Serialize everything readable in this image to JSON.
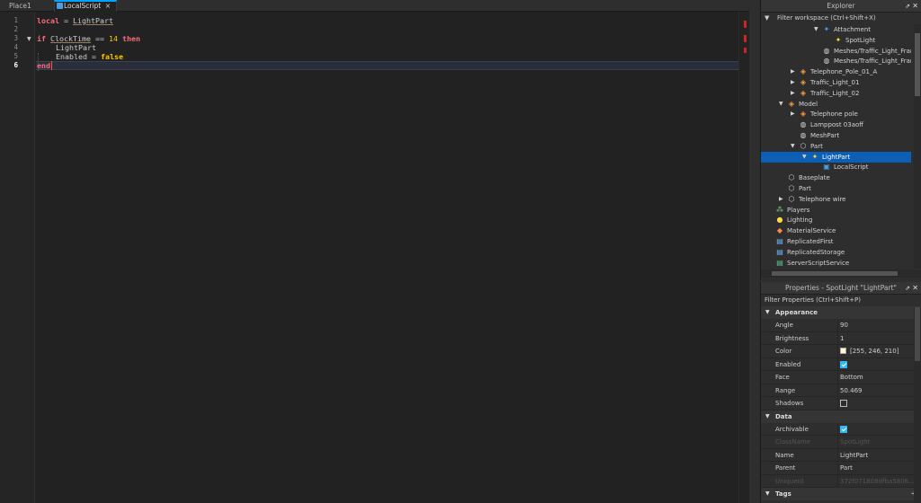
{
  "tabs": [
    {
      "label": "Place1",
      "active": false
    },
    {
      "label": "LocalScript",
      "active": true,
      "close": "×"
    }
  ],
  "editor": {
    "line_numbers": [
      "1",
      "2",
      "3",
      "4",
      "5",
      "6"
    ],
    "current_line": "6",
    "lines": {
      "l1": {
        "kw": "local",
        "op": "=",
        "ident": "LightPart"
      },
      "l3": {
        "kw_if": "if",
        "ident": "ClockTime",
        "op": "==",
        "num": "14",
        "kw_then": "then"
      },
      "l4": {
        "ident": "LightPart"
      },
      "l5": {
        "ident": "Enabled",
        "op": "=",
        "bool": "false"
      },
      "l6": {
        "kw": "end"
      }
    }
  },
  "explorer": {
    "title": "Explorer",
    "filter_placeholder": "Filter workspace (Ctrl+Shift+X)",
    "items": [
      {
        "label": "Attachment",
        "icon": "attachment-icon",
        "indent": 4,
        "arrow": "down"
      },
      {
        "label": "SpotLight",
        "icon": "spotlight-icon",
        "indent": 5,
        "arrow": ""
      },
      {
        "label": "Meshes/Traffic_Light_Frame_S",
        "icon": "mesh-icon",
        "indent": 4,
        "arrow": ""
      },
      {
        "label": "Meshes/Traffic_Light_Frame_S",
        "icon": "mesh-icon",
        "indent": 4,
        "arrow": ""
      },
      {
        "label": "Telephone_Pole_01_A",
        "icon": "model-icon",
        "indent": 2,
        "arrow": "right"
      },
      {
        "label": "Traffic_Light_01",
        "icon": "model-icon",
        "indent": 2,
        "arrow": "right"
      },
      {
        "label": "Traffic_Light_02",
        "icon": "model-icon",
        "indent": 2,
        "arrow": "right"
      },
      {
        "label": "Model",
        "icon": "model-icon",
        "indent": 1,
        "arrow": "down"
      },
      {
        "label": "Telephone pole",
        "icon": "model-icon",
        "indent": 2,
        "arrow": "right"
      },
      {
        "label": "Lamppost 03aoff",
        "icon": "mesh-icon",
        "indent": 2,
        "arrow": ""
      },
      {
        "label": "MeshPart",
        "icon": "mesh-icon",
        "indent": 2,
        "arrow": ""
      },
      {
        "label": "Part",
        "icon": "part-icon",
        "indent": 2,
        "arrow": "down"
      },
      {
        "label": "LightPart",
        "icon": "spotlight-icon",
        "indent": 3,
        "arrow": "down",
        "selected": true
      },
      {
        "label": "LocalScript",
        "icon": "localscript-icon",
        "indent": 4,
        "arrow": ""
      },
      {
        "label": "Baseplate",
        "icon": "part-icon",
        "indent": 1,
        "arrow": ""
      },
      {
        "label": "Part",
        "icon": "part-icon",
        "indent": 1,
        "arrow": ""
      },
      {
        "label": "Telephone wire",
        "icon": "part-icon",
        "indent": 1,
        "arrow": "right"
      },
      {
        "label": "Players",
        "icon": "players-icon",
        "indent": 0,
        "arrow": ""
      },
      {
        "label": "Lighting",
        "icon": "lighting-icon",
        "indent": 0,
        "arrow": ""
      },
      {
        "label": "MaterialService",
        "icon": "material-icon",
        "indent": 0,
        "arrow": ""
      },
      {
        "label": "ReplicatedFirst",
        "icon": "replicated-icon",
        "indent": 0,
        "arrow": ""
      },
      {
        "label": "ReplicatedStorage",
        "icon": "replicated-icon",
        "indent": 0,
        "arrow": ""
      },
      {
        "label": "ServerScriptService",
        "icon": "server-icon",
        "indent": 0,
        "arrow": ""
      }
    ]
  },
  "properties": {
    "title": "Properties - SpotLight \"LightPart\"",
    "filter_placeholder": "Filter Properties (Ctrl+Shift+P)",
    "sections": {
      "appearance": "Appearance",
      "data": "Data",
      "tags": "Tags"
    },
    "appearance": {
      "angle": {
        "name": "Angle",
        "value": "90"
      },
      "brightness": {
        "name": "Brightness",
        "value": "1"
      },
      "color": {
        "name": "Color",
        "value": "[255, 246, 210]",
        "swatch": "#fff6d2"
      },
      "enabled": {
        "name": "Enabled",
        "checked": true
      },
      "face": {
        "name": "Face",
        "value": "Bottom"
      },
      "range": {
        "name": "Range",
        "value": "50.469"
      },
      "shadows": {
        "name": "Shadows",
        "checked": false
      }
    },
    "data": {
      "archivable": {
        "name": "Archivable",
        "checked": true
      },
      "classname": {
        "name": "ClassName",
        "value": "SpotLight"
      },
      "name": {
        "name": "Name",
        "value": "LightPart"
      },
      "parent": {
        "name": "Parent",
        "value": "Part"
      },
      "uniqueid": {
        "name": "UniqueId",
        "value": "372f071808dfba5806..."
      }
    }
  },
  "colors": {
    "selection": "#0b5fb6",
    "keyword": "#f86d7c",
    "literal": "#ffc600",
    "checkbox": "#35b7f2"
  }
}
